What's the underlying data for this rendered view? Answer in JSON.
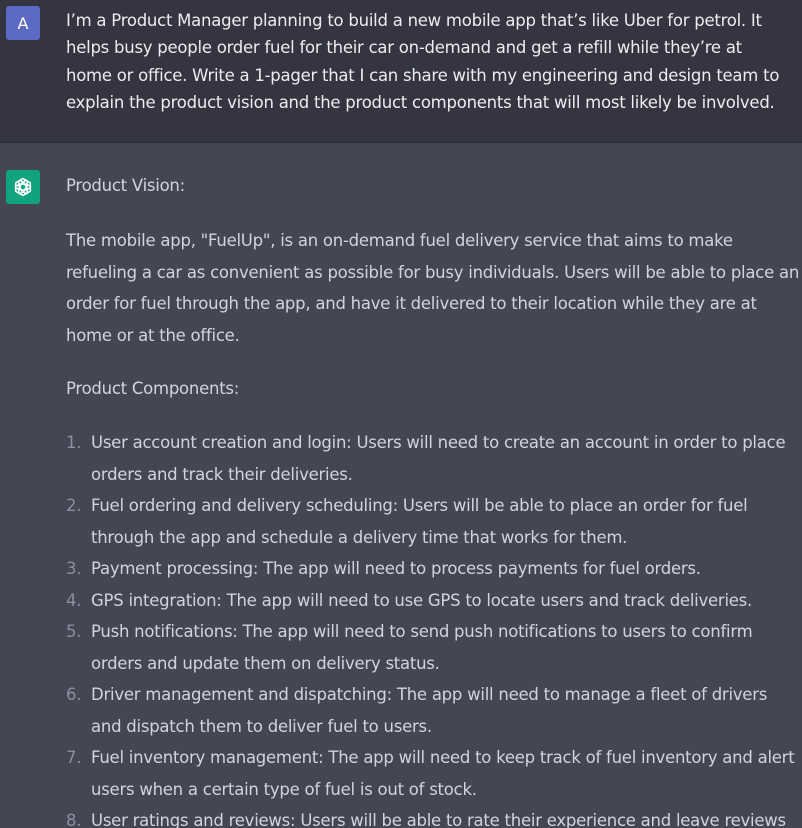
{
  "user_message": {
    "avatar_initial": "A",
    "text": "I’m a Product Manager planning to build a new mobile app that’s like Uber for petrol. It helps busy people order fuel for their car on-demand and get a refill while they’re at home or office. Write a 1-pager that I can share with my engineering and design team to explain the product vision and the product components that will most likely be involved."
  },
  "assistant_message": {
    "avatar_icon": "openai-logo-icon",
    "vision_heading": "Product Vision:",
    "vision_text": "The mobile app, \"FuelUp\", is an on-demand fuel delivery service that aims to make refueling a car as convenient as possible for busy individuals. Users will be able to place an order for fuel through the app, and have it delivered to their location while they are at home or at the office.",
    "components_heading": "Product Components:",
    "components": [
      {
        "num": "1.",
        "text": "User account creation and login: Users will need to create an account in order to place orders and track their deliveries."
      },
      {
        "num": "2.",
        "text": "Fuel ordering and delivery scheduling: Users will be able to place an order for fuel through the app and schedule a delivery time that works for them."
      },
      {
        "num": "3.",
        "text": "Payment processing: The app will need to process payments for fuel orders."
      },
      {
        "num": "4.",
        "text": "GPS integration: The app will need to use GPS to locate users and track deliveries."
      },
      {
        "num": "5.",
        "text": "Push notifications: The app will need to send push notifications to users to confirm orders and update them on delivery status."
      },
      {
        "num": "6.",
        "text": "Driver management and dispatching: The app will need to manage a fleet of drivers and dispatch them to deliver fuel to users."
      },
      {
        "num": "7.",
        "text": "Fuel inventory management: The app will need to keep track of fuel inventory and alert users when a certain type of fuel is out of stock."
      },
      {
        "num": "8.",
        "text": "User ratings and reviews: Users will be able to rate their experience and leave reviews for"
      }
    ]
  },
  "colors": {
    "user_bg": "#343541",
    "assistant_bg": "#444654",
    "user_avatar": "#5c6ac4",
    "assistant_avatar": "#10a37f",
    "text": "#d1d5db"
  }
}
